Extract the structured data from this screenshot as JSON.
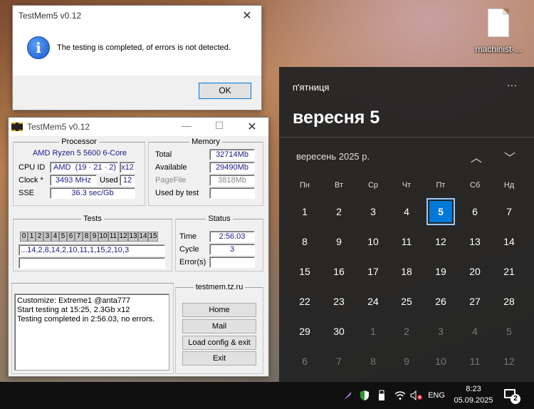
{
  "desktop": {
    "icon_label": "machinist-..."
  },
  "dialog": {
    "title": "TestMem5 v0.12",
    "message": "The testing is completed, of errors is not detected.",
    "ok_label": "OK"
  },
  "testmem": {
    "title": "TestMem5 v0.12",
    "processor": {
      "legend": "Processor",
      "name": "AMD Ryzen 5 5600 6-Core",
      "cpuid_label": "CPU ID",
      "cpuid_vendor": "AMD",
      "cpuid_value": "(19 · 21 · 2)",
      "threads": "x12",
      "clock_label": "Clock *",
      "clock_value": "3493 MHz",
      "used_label": "Used",
      "used_value": "12",
      "sse_label": "SSE",
      "sse_value": "36.3 sec/Gb"
    },
    "memory": {
      "legend": "Memory",
      "total_label": "Total",
      "total_value": "32714Mb",
      "available_label": "Available",
      "available_value": "29490Mb",
      "pagefile_label": "PageFile",
      "pagefile_value": "3818Mb",
      "usedbytest_label": "Used by test",
      "usedbytest_value": ""
    },
    "tests": {
      "legend": "Tests",
      "cells": [
        "0",
        "1",
        "2",
        "3",
        "4",
        "5",
        "6",
        "7",
        "8",
        "9",
        "10",
        "11",
        "12",
        "13",
        "14",
        "15"
      ],
      "sequence": "...14,2,8,14,2,10,11,1,15,2,10,3"
    },
    "status": {
      "legend": "Status",
      "time_label": "Time",
      "time_value": "2:56.03",
      "cycle_label": "Cycle",
      "cycle_value": "3",
      "errors_label": "Error(s)",
      "errors_value": ""
    },
    "log": [
      "Customize: Extreme1 @anta777",
      "Start testing at 15:25, 2.3Gb x12",
      "Testing completed in 2:56.03, no errors."
    ],
    "links": {
      "legend": "testmem.tz.ru",
      "home": "Home",
      "mail": "Mail",
      "load_config": "Load config & exit",
      "exit": "Exit"
    }
  },
  "calendar": {
    "day_of_week": "п'ятниця",
    "big_date": "вересня 5",
    "month_year": "вересень 2025 р.",
    "weekdays": [
      "Пн",
      "Вт",
      "Ср",
      "Чт",
      "Пт",
      "Сб",
      "Нд"
    ],
    "weeks": [
      [
        "1",
        "2",
        "3",
        "4",
        "5",
        "6",
        "7"
      ],
      [
        "8",
        "9",
        "10",
        "11",
        "12",
        "13",
        "14"
      ],
      [
        "15",
        "16",
        "17",
        "18",
        "19",
        "20",
        "21"
      ],
      [
        "22",
        "23",
        "24",
        "25",
        "26",
        "27",
        "28"
      ],
      [
        "29",
        "30",
        "1",
        "2",
        "3",
        "4",
        "5"
      ],
      [
        "6",
        "7",
        "8",
        "9",
        "10",
        "11",
        "12"
      ]
    ],
    "today": "5"
  },
  "taskbar": {
    "lang": "ENG",
    "time": "8:23",
    "date": "05.09.2025",
    "notification_count": "2"
  },
  "colors": {
    "accent": "#0078d7",
    "field_text": "#1a1a8a"
  }
}
